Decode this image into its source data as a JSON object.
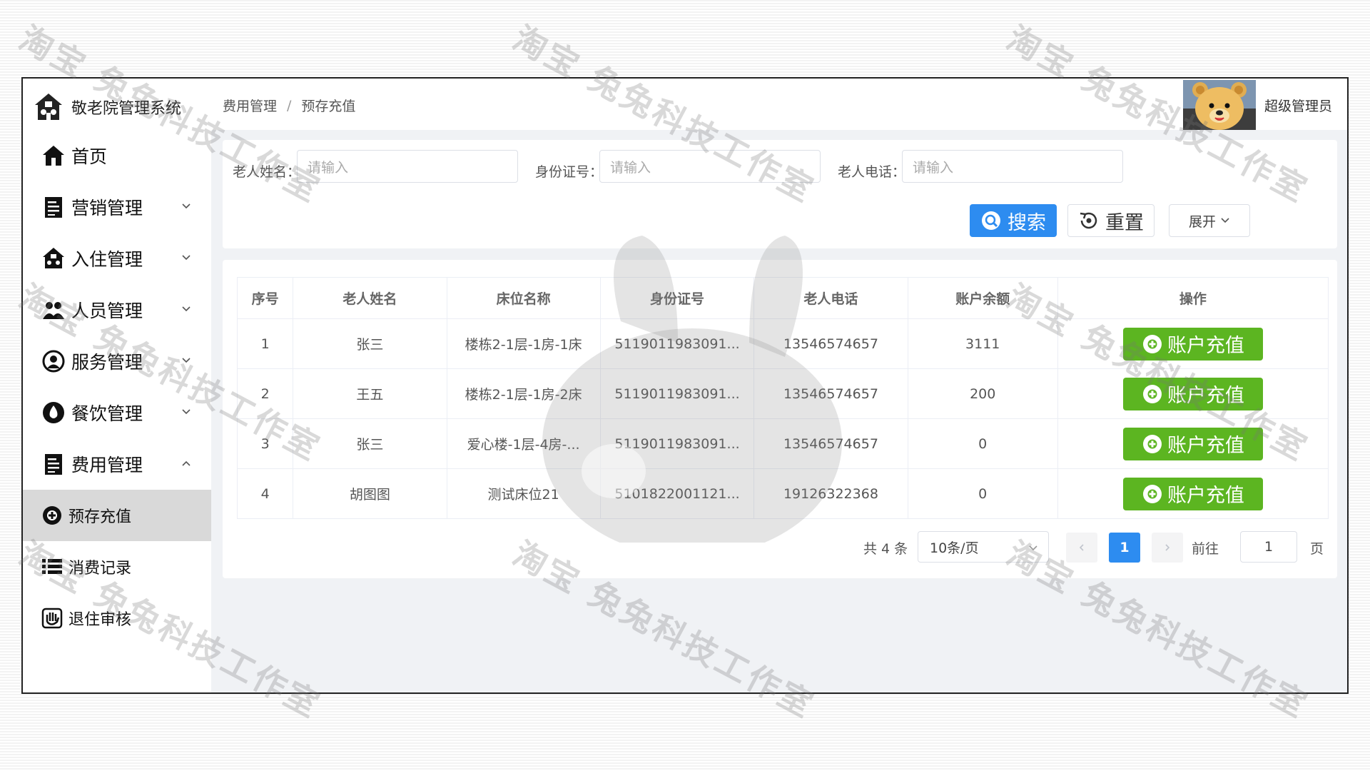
{
  "app": {
    "title": "敬老院管理系统"
  },
  "sidebar": {
    "items": [
      {
        "label": "首页",
        "icon": "home-icon",
        "expandable": false
      },
      {
        "label": "营销管理",
        "icon": "document-icon",
        "expandable": true,
        "expanded": false
      },
      {
        "label": "入住管理",
        "icon": "house-icon",
        "expandable": true,
        "expanded": false
      },
      {
        "label": "人员管理",
        "icon": "people-icon",
        "expandable": true,
        "expanded": false
      },
      {
        "label": "服务管理",
        "icon": "service-icon",
        "expandable": true,
        "expanded": false
      },
      {
        "label": "餐饮管理",
        "icon": "drop-icon",
        "expandable": true,
        "expanded": false
      },
      {
        "label": "费用管理",
        "icon": "document-icon",
        "expandable": true,
        "expanded": true
      }
    ],
    "sub_items": [
      {
        "label": "预存充值",
        "icon": "plus-circle-icon",
        "active": true
      },
      {
        "label": "消费记录",
        "icon": "list-icon",
        "active": false
      },
      {
        "label": "退住审核",
        "icon": "hand-icon",
        "active": false
      }
    ]
  },
  "header": {
    "breadcrumb": [
      "费用管理",
      "预存充值"
    ],
    "breadcrumb_sep": "/",
    "user_name": "超级管理员",
    "avatar": "teddy-bear-avatar"
  },
  "search": {
    "name_label": "老人姓名：",
    "name_placeholder": "请输入",
    "id_label": "身份证号：",
    "id_placeholder": "请输入",
    "phone_label": "老人电话：",
    "phone_placeholder": "请输入",
    "search_label": "搜索",
    "reset_label": "重置",
    "expand_label": "展开"
  },
  "table": {
    "columns": [
      "序号",
      "老人姓名",
      "床位名称",
      "身份证号",
      "老人电话",
      "账户余额",
      "操作"
    ],
    "rows": [
      {
        "index": "1",
        "name": "张三",
        "bed": "楼栋2-1层-1房-1床",
        "id_no": "5119011983091...",
        "phone": "13546574657",
        "balance": "3111"
      },
      {
        "index": "2",
        "name": "王五",
        "bed": "楼栋2-1层-1房-2床",
        "id_no": "5119011983091...",
        "phone": "13546574657",
        "balance": "200"
      },
      {
        "index": "3",
        "name": "张三",
        "bed": "爱心楼-1层-4房-...",
        "id_no": "5119011983091...",
        "phone": "13546574657",
        "balance": "0"
      },
      {
        "index": "4",
        "name": "胡图图",
        "bed": "测试床位21",
        "id_no": "5101822001121...",
        "phone": "19126322368",
        "balance": "0"
      }
    ],
    "action_label": "账户充值"
  },
  "pagination": {
    "total": "共 4 条",
    "page_size": "10条/页",
    "current_page": "1",
    "goto_label": "前往",
    "goto_value": "1",
    "page_unit": "页"
  },
  "colors": {
    "primary": "#2d8cf0",
    "success": "#5cb521",
    "active_menu_bg": "#d9d9d9"
  },
  "watermark": {
    "text": "淘宝 兔兔科技工作室"
  }
}
